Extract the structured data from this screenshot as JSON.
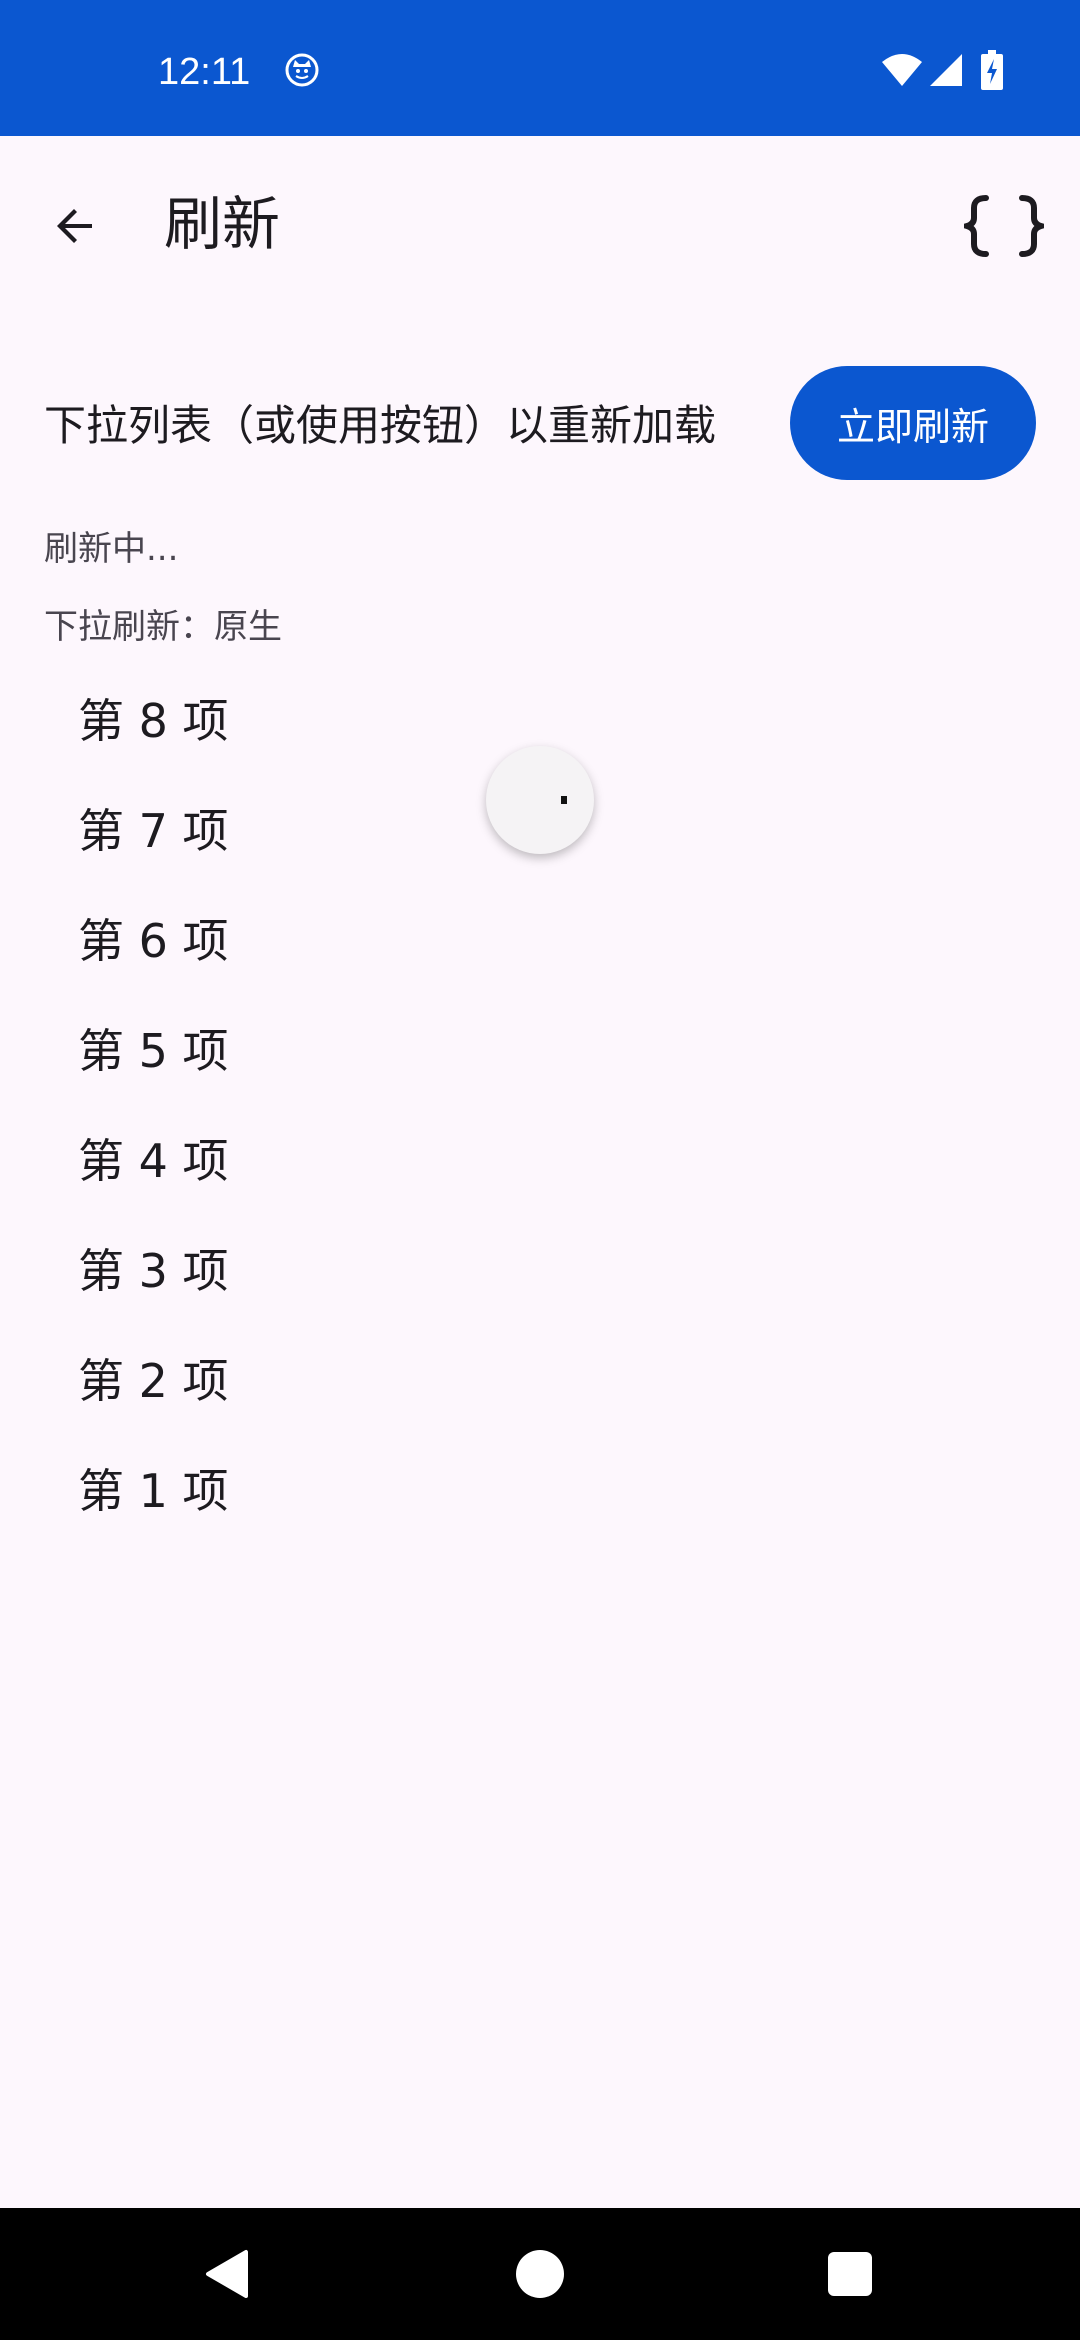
{
  "status_bar": {
    "time": "12:11",
    "notification_icon": "cat-notification-icon",
    "wifi_icon": "wifi-icon",
    "signal_icon": "cell-signal-icon",
    "battery_icon": "battery-charging-icon",
    "background_color": "#0b57d0"
  },
  "app_bar": {
    "back_icon": "arrow-back-icon",
    "title": "刷新",
    "code_icon": "curly-braces-icon"
  },
  "header": {
    "instruction": "下拉列表（或使用按钮）以重新加载",
    "refresh_button_label": "立即刷新",
    "accent_color": "#0b57d0"
  },
  "status": {
    "refreshing": "刷新中...",
    "pull_refresh_mode": "下拉刷新：原生"
  },
  "list": {
    "items": [
      "第 8 项",
      "第 7 项",
      "第 6 项",
      "第 5 项",
      "第 4 项",
      "第 3 项",
      "第 2 项",
      "第 1 项"
    ]
  },
  "refresh_indicator": {
    "icon": "loading-spinner-icon"
  },
  "nav_bar": {
    "back_icon": "nav-back-triangle-icon",
    "home_icon": "nav-home-circle-icon",
    "recents_icon": "nav-recents-square-icon"
  }
}
